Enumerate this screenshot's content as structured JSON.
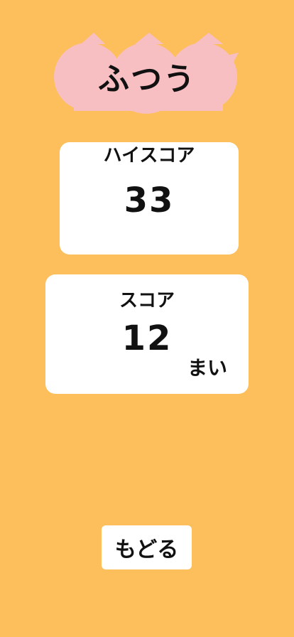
{
  "header": {
    "title": "ふつう"
  },
  "high_score": {
    "label": "ハイスコア",
    "value": "33"
  },
  "score": {
    "label": "スコア",
    "value": "12",
    "unit": "まい"
  },
  "back_button": {
    "label": "もどる"
  },
  "colors": {
    "background": "#FDBE5C",
    "cloud": "#F8BFC2",
    "card": "#FFFFFF",
    "text": "#111111"
  },
  "icons": {
    "title_decoration": "peach-cloud-icon"
  }
}
